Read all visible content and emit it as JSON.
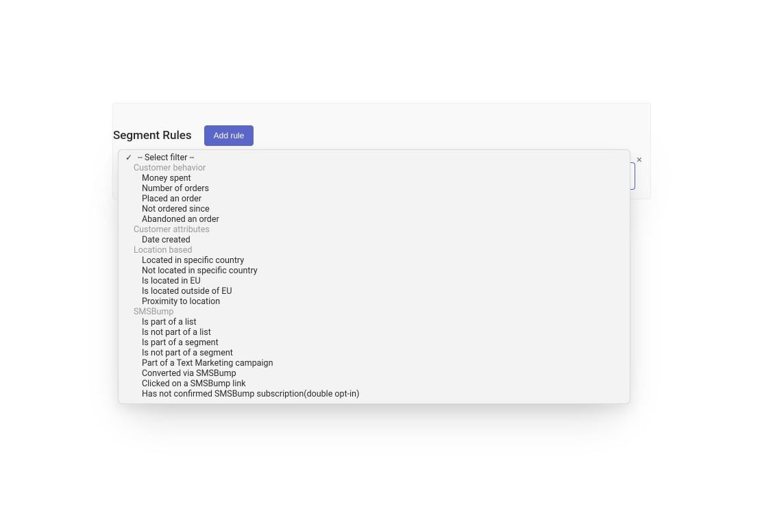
{
  "header": {
    "title": "Segment Rules",
    "add_rule_label": "Add rule"
  },
  "dropdown": {
    "selected_label": "-- Select filter --",
    "groups": [
      {
        "label": "Customer behavior",
        "options": [
          "Money spent",
          "Number of orders",
          "Placed an order",
          "Not ordered since",
          "Abandoned an order"
        ]
      },
      {
        "label": "Customer attributes",
        "options": [
          "Date created"
        ]
      },
      {
        "label": "Location based",
        "options": [
          "Located in specific country",
          "Not located in specific country",
          "Is located in EU",
          "Is located outside of EU",
          "Proximity to location"
        ]
      },
      {
        "label": "SMSBump",
        "options": [
          "Is part of a list",
          "Is not part of a list",
          "Is part of a segment",
          "Is not part of a segment",
          "Part of a Text Marketing campaign",
          "Converted via SMSBump",
          "Clicked on a SMSBump link",
          "Has not confirmed SMSBump subscription(double opt-in)"
        ]
      }
    ]
  },
  "close_label": "×"
}
